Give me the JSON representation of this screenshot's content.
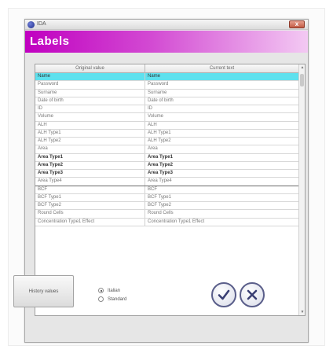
{
  "window": {
    "title": "IDA",
    "close_label": "x"
  },
  "header": {
    "title": "Labels"
  },
  "table": {
    "columns": [
      "Original value",
      "Current text"
    ],
    "rows": [
      [
        "Name",
        "Name"
      ],
      [
        "Password",
        "Password"
      ],
      [
        "Surname",
        "Surname"
      ],
      [
        "Date of birth",
        "Date of birth"
      ],
      [
        "ID",
        "ID"
      ],
      [
        "Volume",
        "Volume"
      ],
      [
        "ALH",
        "ALH"
      ],
      [
        "ALH Type1",
        "ALH Type1"
      ],
      [
        "ALH Type2",
        "ALH Type2"
      ],
      [
        "Area",
        "Area"
      ],
      [
        "Area Type1",
        "Area Type1"
      ],
      [
        "Area Type2",
        "Area Type2"
      ],
      [
        "Area Type3",
        "Area Type3"
      ],
      [
        "Area Type4",
        "Area Type4"
      ],
      [
        "BCF",
        "BCF"
      ],
      [
        "BCF Type1",
        "BCF Type1"
      ],
      [
        "BCF Type2",
        "BCF Type2"
      ],
      [
        "Round Cells",
        "Round Cells"
      ],
      [
        "Concentration Type1 Effect",
        "Concentration Type1 Effect"
      ]
    ],
    "selected_index": 0
  },
  "footer": {
    "history_button": "History values",
    "radio_options": [
      "Italian",
      "Standard"
    ],
    "radio_selected": 0
  },
  "buttons": {
    "ok_icon": "checkmark-icon",
    "cancel_icon": "x-circle-icon"
  },
  "colors": {
    "header_start": "#c000c0",
    "header_end": "#f3c9f3",
    "selected_row": "#5ee1ee",
    "button_ring": "#5a5e8a"
  }
}
